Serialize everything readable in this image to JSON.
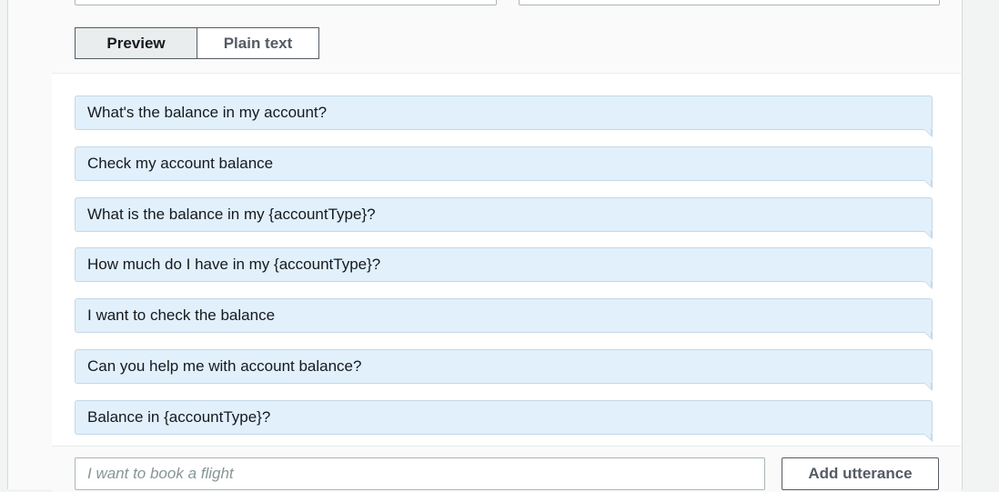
{
  "tabs": {
    "preview": "Preview",
    "plain_text": "Plain text"
  },
  "utterances": [
    "What's the balance in my account?",
    "Check my account balance",
    "What is the balance in my {accountType}?",
    "How much do I have in my {accountType}?",
    "I want to check the balance",
    "Can you help me with account balance?",
    "Balance in {accountType}?"
  ],
  "new_utterance": {
    "placeholder": "I want to book a flight",
    "value": ""
  },
  "add_button_label": "Add utterance",
  "colors": {
    "utterance_bg": "#e1f0fb",
    "utterance_border": "#c5d8e8",
    "active_tab_bg": "#eaeded",
    "border_dark": "#545b64"
  }
}
